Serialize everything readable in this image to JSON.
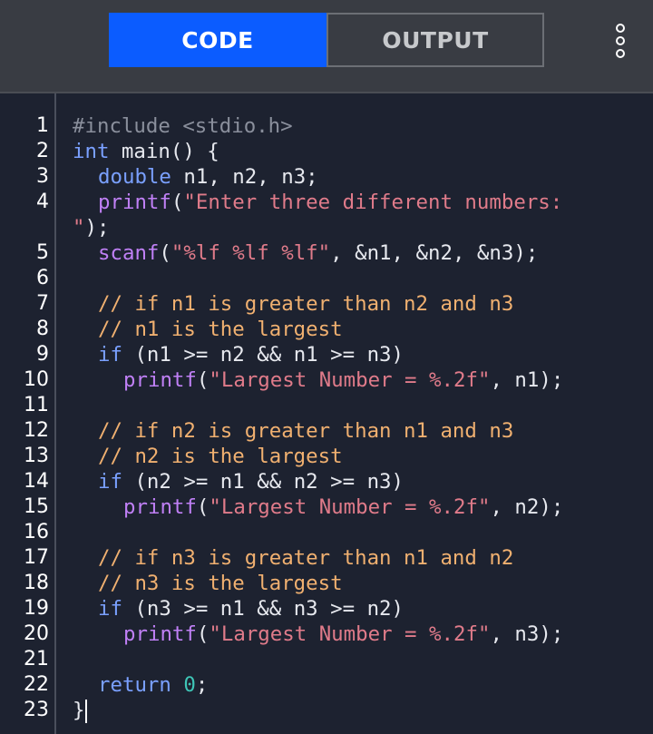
{
  "tabs": {
    "code_label": "CODE",
    "output_label": "OUTPUT",
    "menu_icon": "more-vertical-icon"
  },
  "colors": {
    "active_tab": "#0b5cff",
    "topbar": "#393c43",
    "editor_bg": "#1d2230",
    "keyword": "#7aa0ff",
    "function": "#c080f6",
    "string": "#e07b8a",
    "comment": "#f0b070",
    "number": "#3ec6b7"
  },
  "editor": {
    "line_numbers": [
      "1",
      "2",
      "3",
      "4",
      "5",
      "6",
      "7",
      "8",
      "9",
      "10",
      "11",
      "12",
      "13",
      "14",
      "15",
      "16",
      "17",
      "18",
      "19",
      "20",
      "21",
      "22",
      "23"
    ],
    "lines": {
      "l1": {
        "pp": "#include <stdio.h>"
      },
      "l2": {
        "kw": "int",
        "rest": " main() {"
      },
      "l3": {
        "kw": "double",
        "rest": " n1, n2, n3;"
      },
      "l4": {
        "fn": "printf",
        "p1": "(",
        "str": "\"Enter three different numbers:"
      },
      "l4b": {
        "str": "\"",
        "rest": ");"
      },
      "l5": {
        "fn": "scanf",
        "p1": "(",
        "str": "\"%lf %lf %lf\"",
        "rest": ", &n1, &n2, &n3);"
      },
      "l7": {
        "cm": "// if n1 is greater than n2 and n3"
      },
      "l8": {
        "cm": "// n1 is the largest"
      },
      "l9": {
        "kw": "if",
        "rest": " (n1 >= n2 && n1 >= n3)"
      },
      "l10": {
        "fn": "printf",
        "p1": "(",
        "str": "\"Largest Number = %.2f\"",
        "rest": ", n1);"
      },
      "l12": {
        "cm": "// if n2 is greater than n1 and n3"
      },
      "l13": {
        "cm": "// n2 is the largest"
      },
      "l14": {
        "kw": "if",
        "rest": " (n2 >= n1 && n2 >= n3)"
      },
      "l15": {
        "fn": "printf",
        "p1": "(",
        "str": "\"Largest Number = %.2f\"",
        "rest": ", n2);"
      },
      "l17": {
        "cm": "// if n3 is greater than n1 and n2"
      },
      "l18": {
        "cm": "// n3 is the largest"
      },
      "l19": {
        "kw": "if",
        "rest": " (n3 >= n1 && n3 >= n2)"
      },
      "l20": {
        "fn": "printf",
        "p1": "(",
        "str": "\"Largest Number = %.2f\"",
        "rest": ", n3);"
      },
      "l22": {
        "kw": "return",
        "num": "0",
        "rest": ";"
      },
      "l23": {
        "rest": "}"
      }
    }
  }
}
